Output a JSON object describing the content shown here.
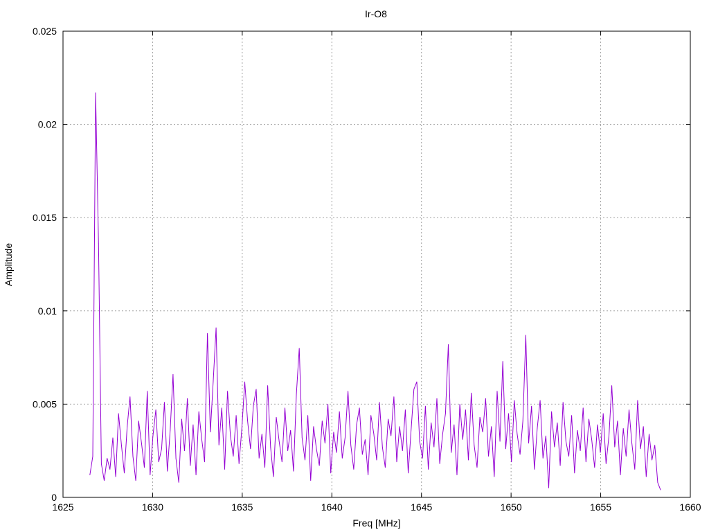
{
  "chart_data": {
    "type": "line",
    "title": "Ir-O8",
    "xlabel": "Freq [MHz]",
    "ylabel": "Amplitude",
    "xlim": [
      1625,
      1660
    ],
    "ylim": [
      0,
      0.025
    ],
    "grid": true,
    "xticks": [
      "1625",
      "1630",
      "1635",
      "1640",
      "1645",
      "1650",
      "1655",
      "1660"
    ],
    "yticks": [
      "0",
      "0.005",
      "0.01",
      "0.015",
      "0.02",
      "0.025"
    ],
    "xtick_values": [
      1625,
      1630,
      1635,
      1640,
      1645,
      1650,
      1655,
      1660
    ],
    "ytick_values": [
      0,
      0.005,
      0.01,
      0.015,
      0.02,
      0.025
    ],
    "series": [
      {
        "name": "Ir-O8",
        "color": "#9400d3",
        "x_start": 1626.5,
        "x_step": 0.16,
        "values": [
          0.0012,
          0.0022,
          0.0217,
          0.0136,
          0.0018,
          0.0009,
          0.0021,
          0.0015,
          0.0032,
          0.0011,
          0.0045,
          0.0028,
          0.0013,
          0.0038,
          0.0054,
          0.0022,
          0.0009,
          0.0041,
          0.0029,
          0.0016,
          0.0057,
          0.0012,
          0.0033,
          0.0047,
          0.0019,
          0.0026,
          0.0051,
          0.0014,
          0.0036,
          0.0066,
          0.0021,
          0.0008,
          0.0042,
          0.0025,
          0.0053,
          0.0017,
          0.0039,
          0.0012,
          0.0046,
          0.0031,
          0.0019,
          0.0088,
          0.0035,
          0.0062,
          0.0091,
          0.0028,
          0.0048,
          0.0015,
          0.0057,
          0.0033,
          0.0022,
          0.0044,
          0.0018,
          0.0037,
          0.0062,
          0.0041,
          0.0026,
          0.0049,
          0.0058,
          0.0021,
          0.0034,
          0.0016,
          0.006,
          0.0027,
          0.0011,
          0.0043,
          0.003,
          0.0019,
          0.0048,
          0.0025,
          0.0036,
          0.0014,
          0.0055,
          0.008,
          0.0032,
          0.002,
          0.0044,
          0.0009,
          0.0038,
          0.0026,
          0.0017,
          0.0041,
          0.0029,
          0.005,
          0.0013,
          0.0035,
          0.0024,
          0.0046,
          0.0021,
          0.0032,
          0.0057,
          0.0028,
          0.0015,
          0.0039,
          0.0048,
          0.0023,
          0.0031,
          0.0012,
          0.0044,
          0.0034,
          0.002,
          0.0051,
          0.0027,
          0.0016,
          0.0042,
          0.0033,
          0.0054,
          0.0019,
          0.0038,
          0.0025,
          0.0047,
          0.0013,
          0.0036,
          0.0058,
          0.0062,
          0.003,
          0.0021,
          0.0049,
          0.0015,
          0.004,
          0.0027,
          0.0053,
          0.0018,
          0.0034,
          0.0045,
          0.0082,
          0.0024,
          0.0039,
          0.0012,
          0.005,
          0.0031,
          0.0047,
          0.002,
          0.0056,
          0.0028,
          0.0016,
          0.0043,
          0.0035,
          0.0053,
          0.0022,
          0.0038,
          0.0011,
          0.0057,
          0.003,
          0.0073,
          0.0026,
          0.0045,
          0.0019,
          0.0052,
          0.0034,
          0.0023,
          0.0041,
          0.0087,
          0.0029,
          0.0049,
          0.0015,
          0.0037,
          0.0052,
          0.0021,
          0.0033,
          0.0005,
          0.0046,
          0.0027,
          0.004,
          0.0017,
          0.0051,
          0.003,
          0.0022,
          0.0044,
          0.0013,
          0.0036,
          0.0025,
          0.0048,
          0.0019,
          0.0042,
          0.0031,
          0.0016,
          0.0039,
          0.0024,
          0.0045,
          0.0018,
          0.0033,
          0.006,
          0.0027,
          0.0041,
          0.0012,
          0.0037,
          0.0022,
          0.0047,
          0.0029,
          0.0015,
          0.0052,
          0.0026,
          0.0038,
          0.0011,
          0.0034,
          0.002,
          0.0028,
          0.0008,
          0.0004
        ]
      }
    ]
  }
}
